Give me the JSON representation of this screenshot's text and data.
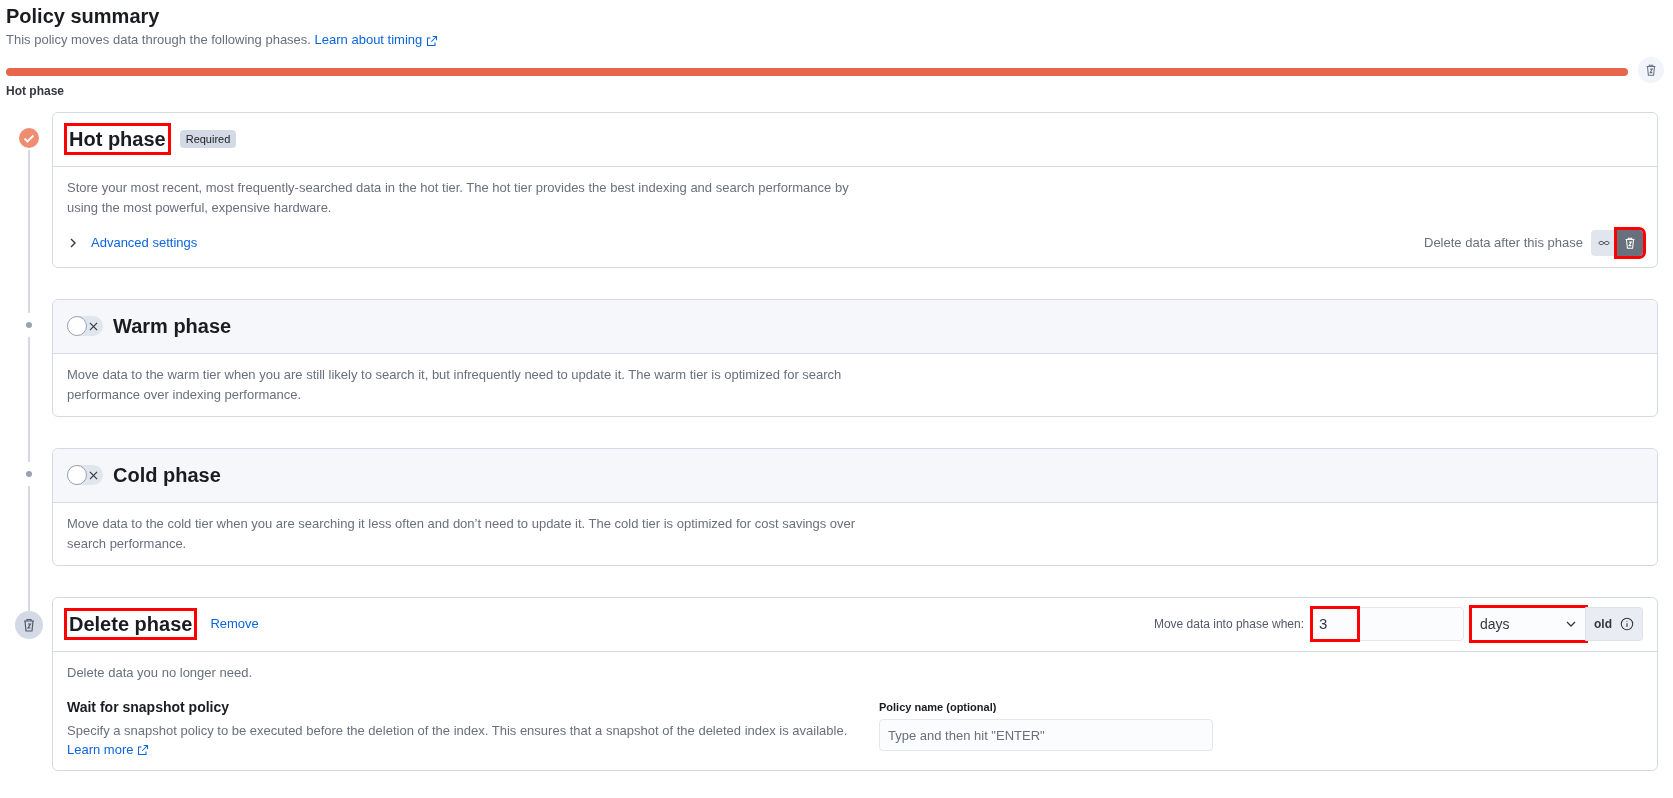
{
  "header": {
    "title": "Policy summary",
    "subtitle": "This policy moves data through the following phases.",
    "link": "Learn about timing"
  },
  "timeline_bar": {
    "segments": [
      {
        "label": "Hot phase",
        "color": "#e7664c"
      }
    ]
  },
  "phases": [
    {
      "kind": "hot",
      "title": "Hot phase",
      "highlighted": true,
      "badge": "Required",
      "description": "Store your most recent, most frequently-searched data in the hot tier. The hot tier provides the best indexing and search performance by using the most powerful, expensive hardware.",
      "advanced": {
        "label": "Advanced settings",
        "expanded": false
      },
      "delete_after": {
        "label": "Delete data after this phase",
        "options": [
          {
            "kind": "forever",
            "selected": false,
            "highlighted": false
          },
          {
            "kind": "delete",
            "selected": true,
            "highlighted": true
          }
        ]
      }
    },
    {
      "kind": "optional",
      "title": "Warm phase",
      "highlighted": false,
      "enabled": false,
      "description": "Move data to the warm tier when you are still likely to search it, but infrequently need to update it. The warm tier is optimized for search performance over indexing performance."
    },
    {
      "kind": "optional",
      "title": "Cold phase",
      "highlighted": false,
      "enabled": false,
      "description": "Move data to the cold tier when you are searching it less often and don’t need to update it. The cold tier is optimized for cost savings over search performance."
    },
    {
      "kind": "delete",
      "title": "Delete phase",
      "highlighted": true,
      "remove": "Remove",
      "move_when": {
        "label": "Move data into phase when:",
        "value": "3",
        "value_highlighted": true,
        "unit": "days",
        "unit_highlighted": true,
        "append": "old"
      },
      "description": "Delete data you no longer need.",
      "snapshot": {
        "title": "Wait for snapshot policy",
        "text": "Specify a snapshot policy to be executed before the deletion of the index. This ensures that a snapshot of the deleted index is available.",
        "link": "Learn more",
        "field_label": "Policy name (optional)",
        "placeholder": "Type and then hit \"ENTER\""
      }
    }
  ]
}
